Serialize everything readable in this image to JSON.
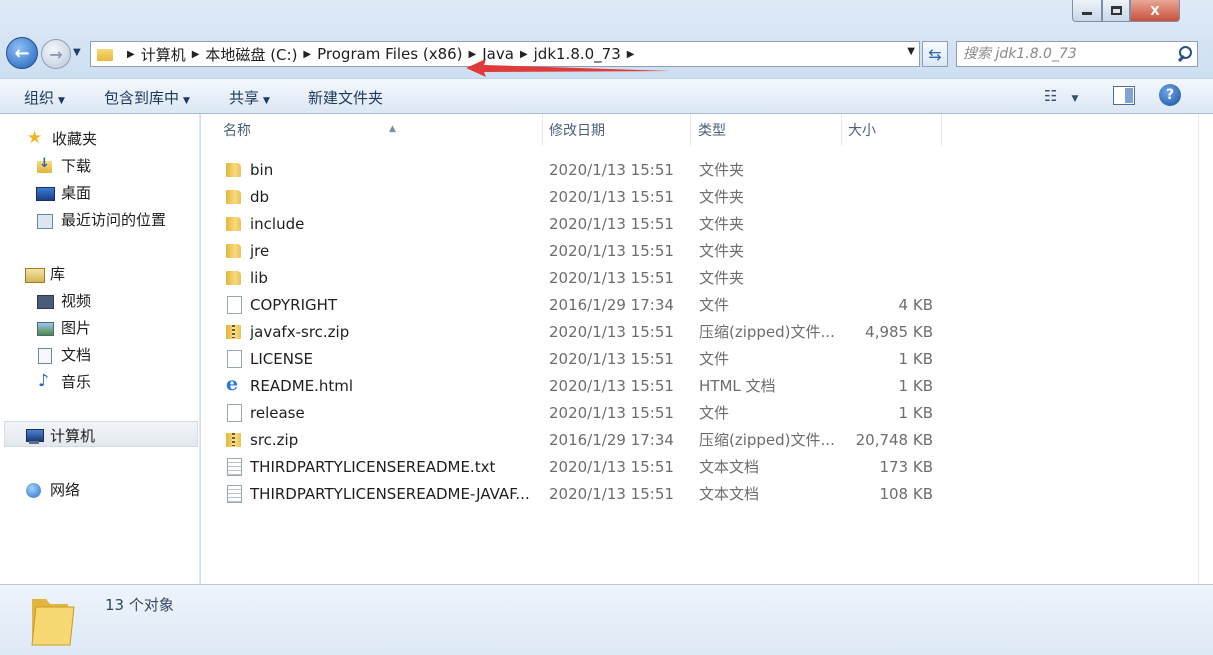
{
  "window": {
    "caption_minimize": "",
    "caption_maximize": "",
    "caption_close": "X"
  },
  "address": {
    "crumbs": [
      "计算机",
      "本地磁盘 (C:)",
      "Program Files (x86)",
      "Java",
      "jdk1.8.0_73"
    ]
  },
  "search": {
    "placeholder": "搜索 jdk1.8.0_73"
  },
  "toolbar": {
    "organize": "组织",
    "include_in_library": "包含到库中",
    "share": "共享",
    "new_folder": "新建文件夹",
    "help": "?"
  },
  "nav": {
    "favorites": "收藏夹",
    "downloads": "下载",
    "desktop": "桌面",
    "recent": "最近访问的位置",
    "libraries": "库",
    "videos": "视频",
    "pictures": "图片",
    "documents": "文档",
    "music": "音乐",
    "computer": "计算机",
    "network": "网络"
  },
  "columns": {
    "name": "名称",
    "date": "修改日期",
    "type": "类型",
    "size": "大小"
  },
  "files": [
    {
      "icon": "folder-icon",
      "name": "bin",
      "date": "2020/1/13 15:51",
      "type": "文件夹",
      "size": ""
    },
    {
      "icon": "folder-icon",
      "name": "db",
      "date": "2020/1/13 15:51",
      "type": "文件夹",
      "size": ""
    },
    {
      "icon": "folder-icon",
      "name": "include",
      "date": "2020/1/13 15:51",
      "type": "文件夹",
      "size": ""
    },
    {
      "icon": "folder-icon",
      "name": "jre",
      "date": "2020/1/13 15:51",
      "type": "文件夹",
      "size": ""
    },
    {
      "icon": "folder-icon",
      "name": "lib",
      "date": "2020/1/13 15:51",
      "type": "文件夹",
      "size": ""
    },
    {
      "icon": "file-icon",
      "name": "COPYRIGHT",
      "date": "2016/1/29 17:34",
      "type": "文件",
      "size": "4 KB"
    },
    {
      "icon": "zip-icon",
      "name": "javafx-src.zip",
      "date": "2020/1/13 15:51",
      "type": "压缩(zipped)文件...",
      "size": "4,985 KB"
    },
    {
      "icon": "file-icon",
      "name": "LICENSE",
      "date": "2020/1/13 15:51",
      "type": "文件",
      "size": "1 KB"
    },
    {
      "icon": "ie-html-icon",
      "name": "README.html",
      "date": "2020/1/13 15:51",
      "type": "HTML 文档",
      "size": "1 KB"
    },
    {
      "icon": "file-icon",
      "name": "release",
      "date": "2020/1/13 15:51",
      "type": "文件",
      "size": "1 KB"
    },
    {
      "icon": "zip-icon",
      "name": "src.zip",
      "date": "2016/1/29 17:34",
      "type": "压缩(zipped)文件...",
      "size": "20,748 KB"
    },
    {
      "icon": "text-file-icon",
      "name": "THIRDPARTYLICENSEREADME.txt",
      "date": "2020/1/13 15:51",
      "type": "文本文档",
      "size": "173 KB"
    },
    {
      "icon": "text-file-icon",
      "name": "THIRDPARTYLICENSEREADME-JAVAF...",
      "date": "2020/1/13 15:51",
      "type": "文本文档",
      "size": "108 KB"
    }
  ],
  "status": {
    "item_count": "13 个对象"
  },
  "colors": {
    "annotation_arrow": "#e03a3a",
    "chrome_bg": "#cfe0f1",
    "toolbar_text": "#1e395b"
  }
}
